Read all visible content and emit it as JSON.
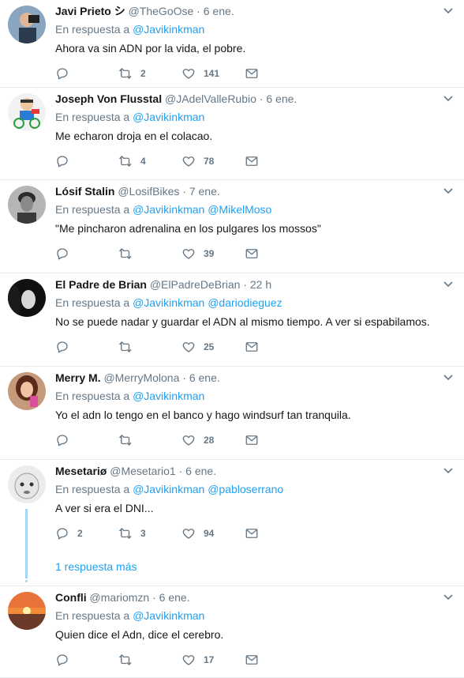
{
  "tweets": [
    {
      "name": "Javi Prieto シ",
      "handle": "@TheGoOse",
      "time": "6 ene.",
      "reply_prefix": "En respuesta a",
      "mentions": [
        "@Javikinkman"
      ],
      "text": "Ahora va sin ADN por la vida, el pobre.",
      "replies": "",
      "retweets": "2",
      "likes": "141",
      "avatar": "person-camera"
    },
    {
      "name": "Joseph Von Flusstal",
      "handle": "@JAdelValleRubio",
      "time": "6 ene.",
      "reply_prefix": "En respuesta a",
      "mentions": [
        "@Javikinkman"
      ],
      "text": "Me echaron droja en el colacao.",
      "replies": "",
      "retweets": "4",
      "likes": "78",
      "avatar": "cartoon-cyclist"
    },
    {
      "name": "Lósif Stalin",
      "handle": "@LosifBikes",
      "time": "7 ene.",
      "reply_prefix": "En respuesta a",
      "mentions": [
        "@Javikinkman",
        "@MikelMoso"
      ],
      "text": "\"Me pincharon adrenalina en los pulgares los mossos\"",
      "replies": "",
      "retweets": "",
      "likes": "39",
      "avatar": "bw-portrait"
    },
    {
      "name": "El Padre de Brian",
      "handle": "@ElPadreDeBrian",
      "time": "22 h",
      "reply_prefix": "En respuesta a",
      "mentions": [
        "@Javikinkman",
        "@dariodieguez"
      ],
      "text": "No se puede nadar y guardar el ADN al mismo tiempo.  A ver si espabilamos.",
      "replies": "",
      "retweets": "",
      "likes": "25",
      "avatar": "dark-portrait"
    },
    {
      "name": "Merry M.",
      "handle": "@MerryMolona",
      "time": "6 ene.",
      "reply_prefix": "En respuesta a",
      "mentions": [
        "@Javikinkman"
      ],
      "text": "Yo el adn lo tengo en el banco y  hago windsurf tan tranquila.",
      "replies": "",
      "retweets": "",
      "likes": "28",
      "avatar": "woman-portrait"
    },
    {
      "name": "Mesetariø",
      "handle": "@Mesetario1",
      "time": "6 ene.",
      "reply_prefix": "En respuesta a",
      "mentions": [
        "@Javikinkman",
        "@pabloserrano"
      ],
      "text": "A ver si era el DNI...",
      "replies": "2",
      "retweets": "3",
      "likes": "94",
      "avatar": "baby-face",
      "more_replies": "1 respuesta más"
    },
    {
      "name": "Confli",
      "handle": "@mariomzn",
      "time": "6 ene.",
      "reply_prefix": "En respuesta a",
      "mentions": [
        "@Javikinkman"
      ],
      "text": "Quien dice el Adn, dice el cerebro.",
      "replies": "",
      "retweets": "",
      "likes": "17",
      "avatar": "sunset"
    }
  ],
  "colors": {
    "link": "#1da1f2",
    "muted": "#657786",
    "text": "#14171a",
    "divider": "#e6ecf0",
    "thread": "#a6d4f5"
  }
}
